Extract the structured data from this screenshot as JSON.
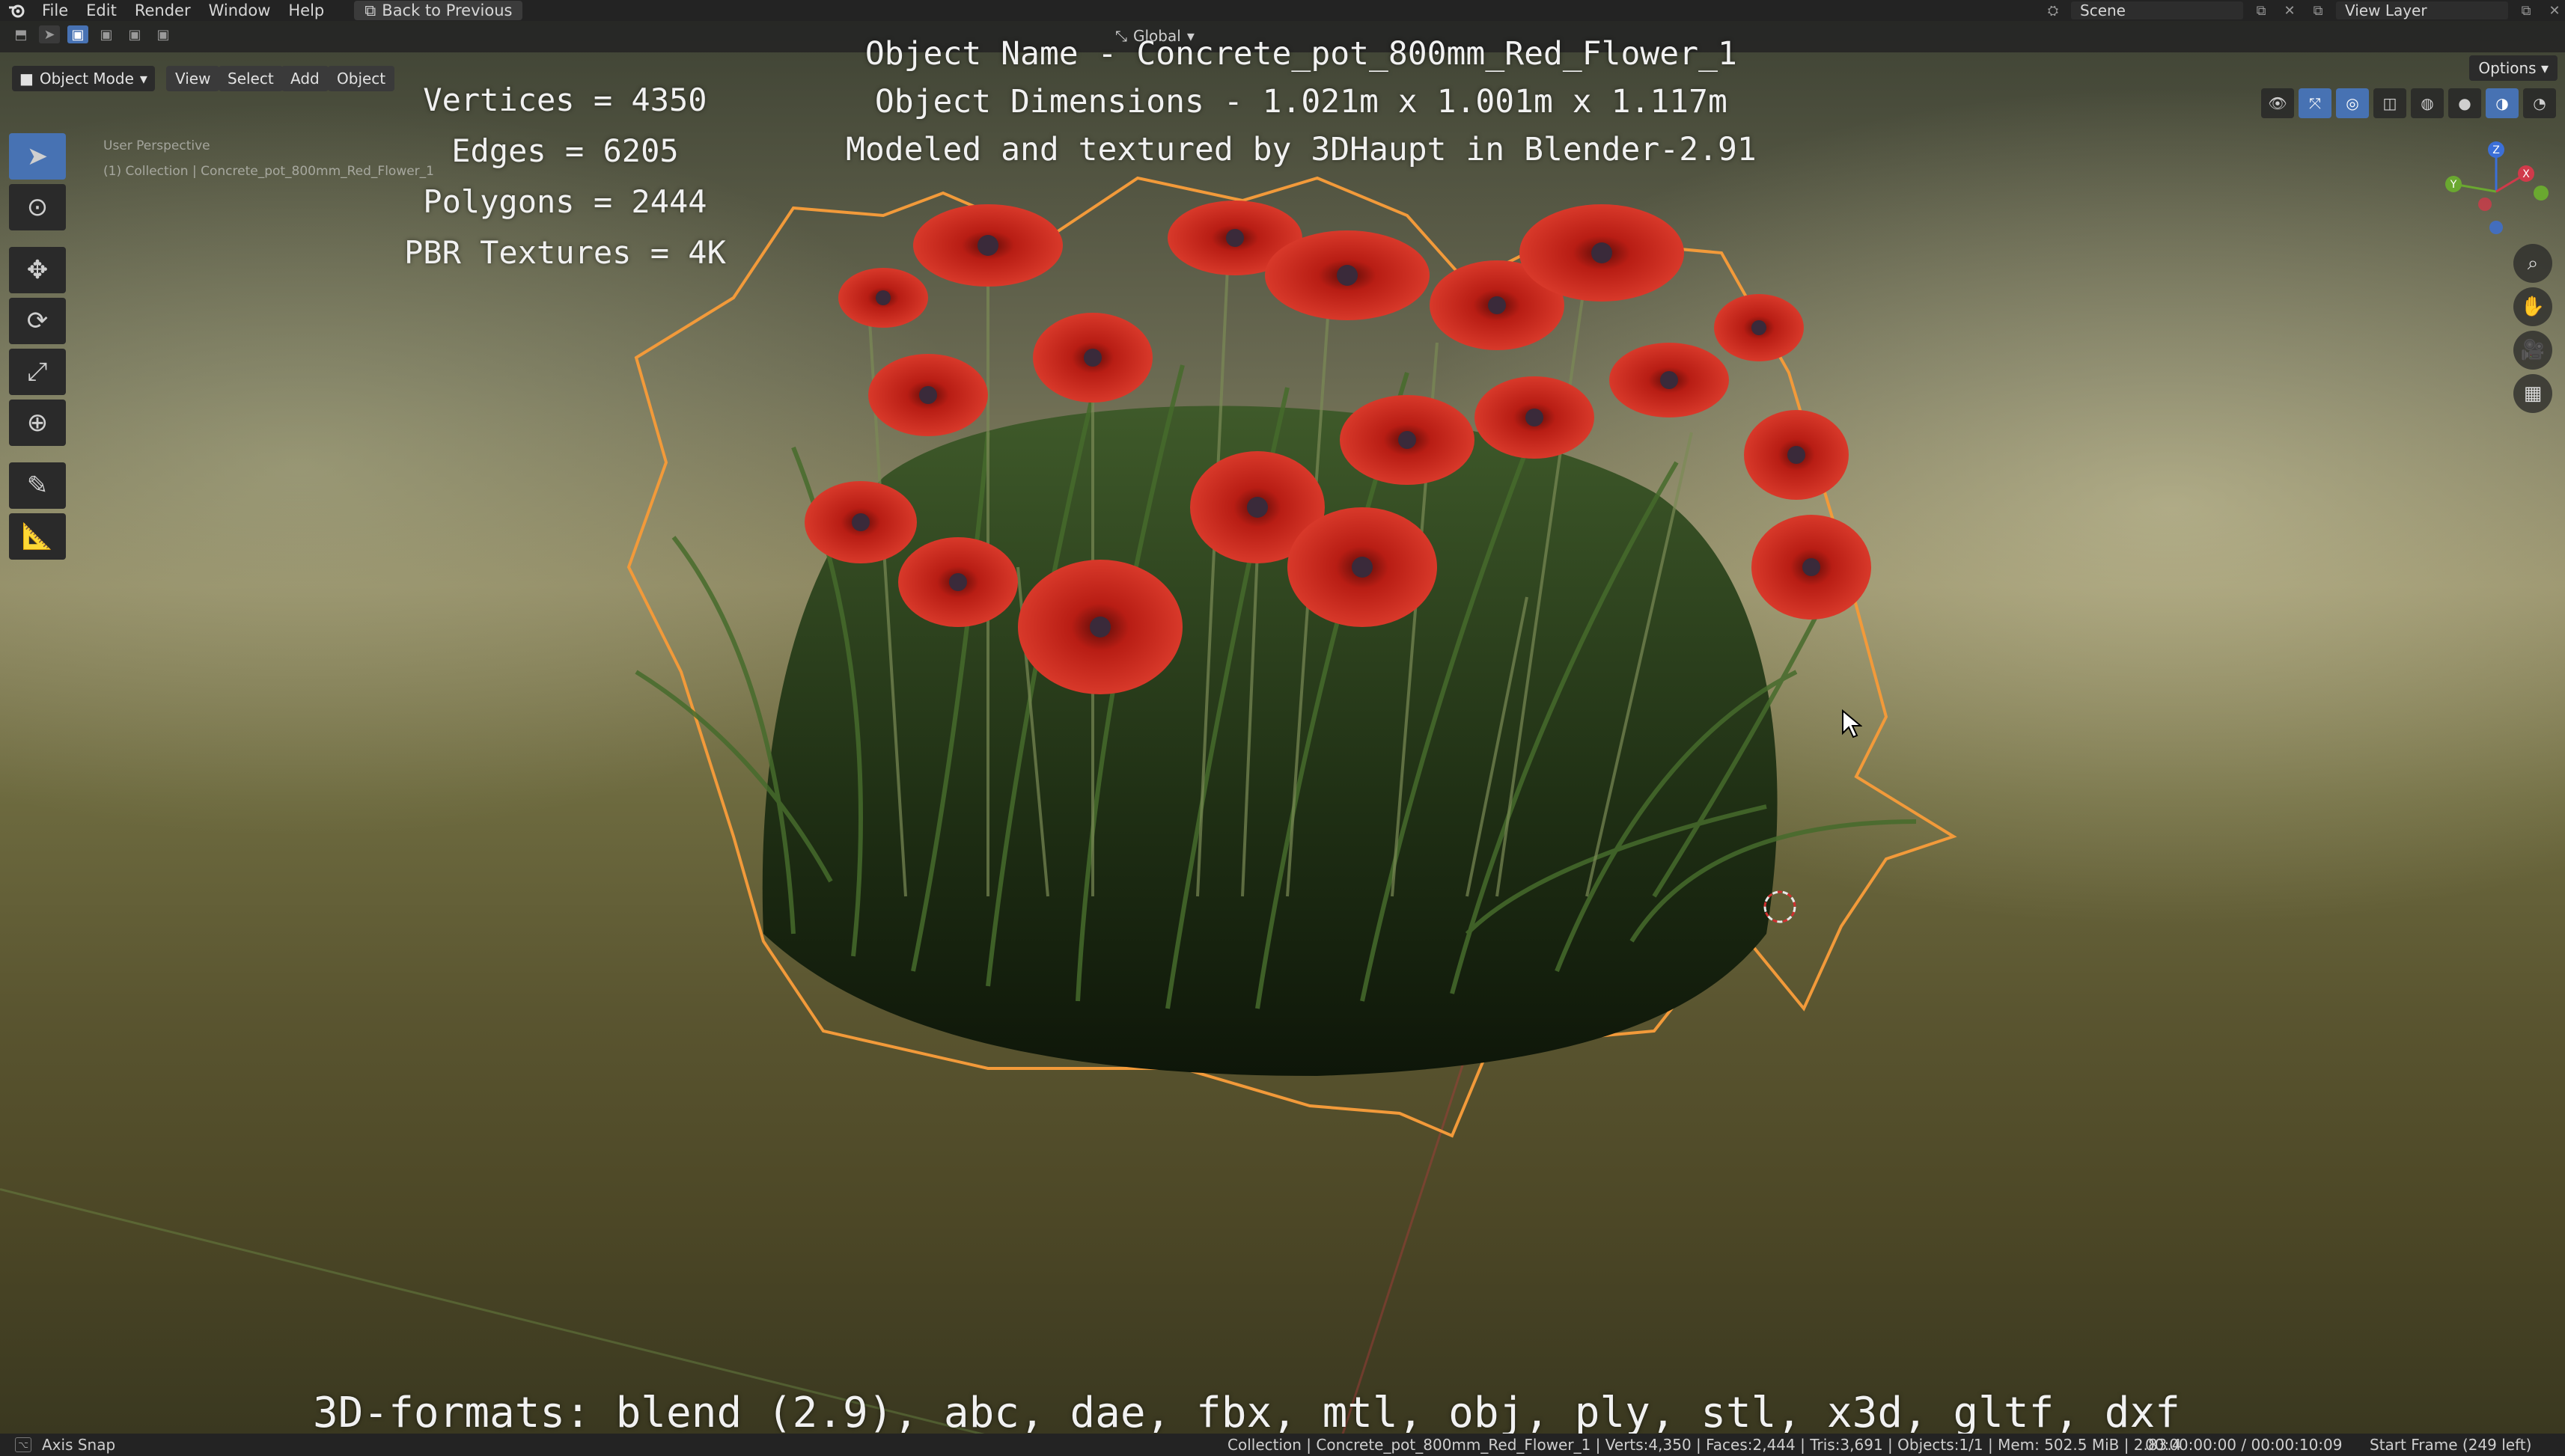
{
  "menubar": {
    "items": [
      "File",
      "Edit",
      "Render",
      "Window",
      "Help"
    ],
    "back_button": "Back to Previous",
    "scene": "Scene",
    "view_layer": "View Layer"
  },
  "viewport": {
    "mode": "Object Mode",
    "menus": [
      "View",
      "Select",
      "Add",
      "Object"
    ],
    "options": "Options",
    "orientation": "Global",
    "info_line1": "User Perspective",
    "info_line2": "(1) Collection | Concrete_pot_800mm_Red_Flower_1"
  },
  "overlay": {
    "vertices": "Vertices = 4350",
    "edges": "Edges = 6205",
    "polygons": "Polygons = 2444",
    "textures": "PBR Textures = 4K",
    "object_name": "Object Name - Concrete_pot_800mm_Red_Flower_1",
    "dimensions": "Object Dimensions -  1.021m x 1.001m x 1.117m",
    "credits": "Modeled and textured by 3DHaupt in Blender-2.91",
    "formats": "3D-formats: blend (2.9), abc, dae, fbx, mtl, obj, ply, stl, x3d, gltf, dxf"
  },
  "gizmo": {
    "x": "X",
    "y": "Y",
    "z": "Z"
  },
  "statusbar": {
    "left": "Axis Snap",
    "stats": "Collection | Concrete_pot_800mm_Red_Flower_1 | Verts:4,350 | Faces:2,444 | Tris:3,691 | Objects:1/1 | Mem: 502.5 MiB | 2.83.4",
    "time": "00:00:00:00 / 00:00:10:09",
    "frame": "Start Frame (249 left)"
  },
  "colors": {
    "accent": "#4772b3",
    "selection_outline": "#f29a3a",
    "flower": "#c8201a"
  }
}
